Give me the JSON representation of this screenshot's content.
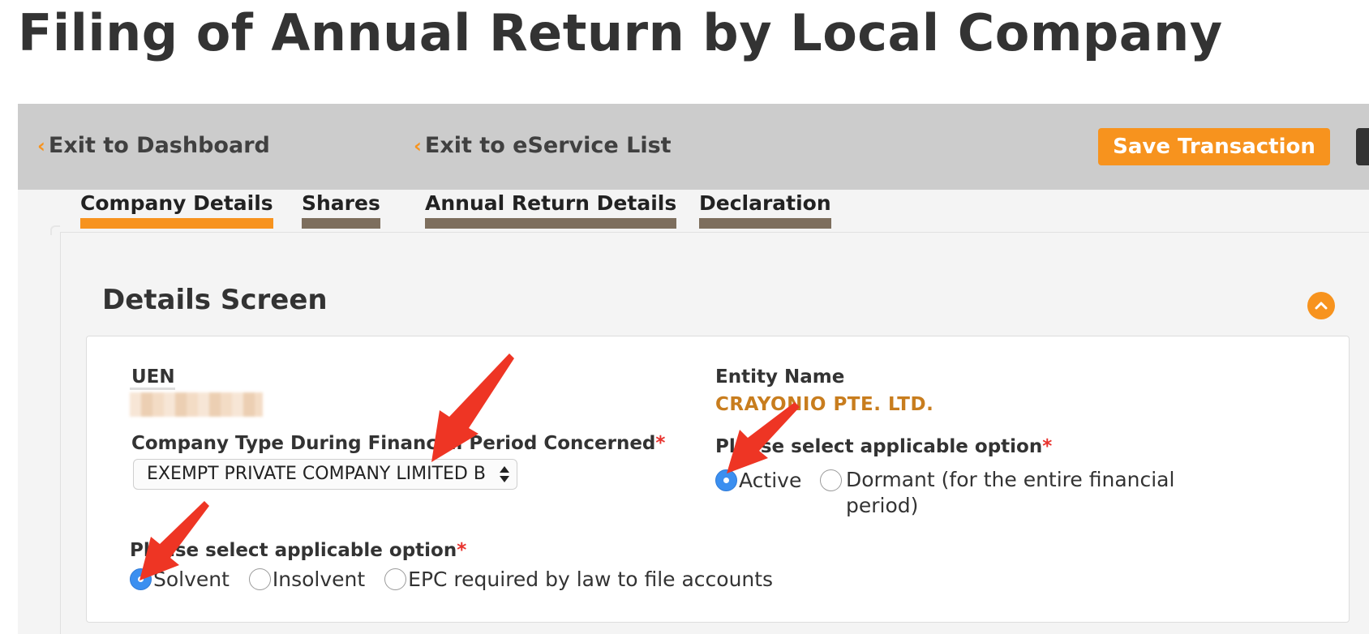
{
  "page": {
    "title": "Filing of Annual Return by Local Company"
  },
  "toolbar": {
    "exit_dashboard": "Exit to Dashboard",
    "exit_eservice": "Exit to eService List",
    "save_label": "Save Transaction"
  },
  "tabs": [
    {
      "label": "Company Details",
      "active": true
    },
    {
      "label": "Shares",
      "active": false
    },
    {
      "label": "Annual Return Details",
      "active": false
    },
    {
      "label": "Declaration",
      "active": false
    }
  ],
  "section": {
    "title": "Details Screen"
  },
  "form": {
    "uen": {
      "label": "UEN"
    },
    "entity": {
      "label": "Entity Name",
      "value": "CRAYONIO PTE. LTD."
    },
    "company_type": {
      "label": "Company Type During Financial Period Concerned",
      "required_mark": "*",
      "selected": "EXEMPT PRIVATE COMPANY LIMITED B"
    },
    "status": {
      "label": "Please select applicable option",
      "required_mark": "*",
      "options": [
        {
          "label": "Active",
          "selected": true
        },
        {
          "label": "Dormant (for the entire financial period)",
          "selected": false
        }
      ]
    },
    "solvency": {
      "label": "Please select applicable option",
      "required_mark": "*",
      "options": [
        {
          "label": "Solvent",
          "selected": true
        },
        {
          "label": "Insolvent",
          "selected": false
        },
        {
          "label": "EPC required by law to file accounts",
          "selected": false
        }
      ]
    }
  },
  "colors": {
    "accent_orange": "#f7931e",
    "toolbar_gray": "#cccccc",
    "entity_name": "#c87d1e",
    "radio_selected": "#3b8ff0",
    "required": "#e8322d",
    "annotation_arrow": "#ee3524"
  },
  "icons": {
    "back": "chevron-left-icon",
    "collapse": "chevron-up-icon",
    "select": "select-arrows-icon",
    "annotation": "red-arrow-annotation"
  }
}
